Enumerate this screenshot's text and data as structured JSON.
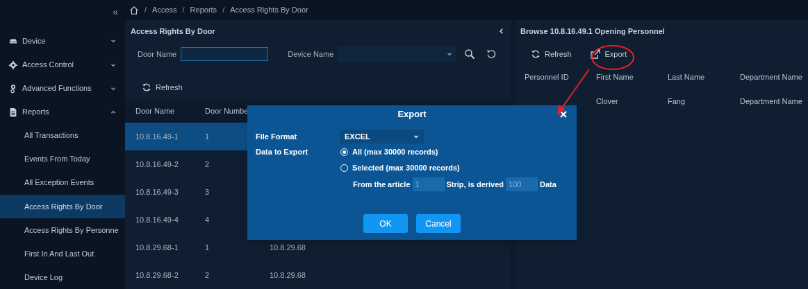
{
  "sidebar": {
    "collapse": "«",
    "menus": [
      {
        "label": "Device",
        "expanded": false
      },
      {
        "label": "Access Control",
        "expanded": false
      },
      {
        "label": "Advanced Functions",
        "expanded": false
      },
      {
        "label": "Reports",
        "expanded": true,
        "children": [
          {
            "label": "All Transactions",
            "selected": false
          },
          {
            "label": "Events From Today",
            "selected": false
          },
          {
            "label": "All Exception Events",
            "selected": false
          },
          {
            "label": "Access Rights By Door",
            "selected": true
          },
          {
            "label": "Access Rights By Personne",
            "selected": false
          },
          {
            "label": "First In And Last Out",
            "selected": false
          },
          {
            "label": "Device Log",
            "selected": false
          }
        ]
      }
    ]
  },
  "breadcrumb": {
    "separator": "/",
    "items": [
      "Access",
      "Reports",
      "Access Rights By Door"
    ]
  },
  "door_panel": {
    "title": "Access Rights By Door",
    "filters": [
      {
        "label": "Door Name",
        "kind": "text"
      },
      {
        "label": "Device Name",
        "kind": "select"
      }
    ],
    "refresh": "Refresh",
    "columns": [
      "Door Name",
      "Door Numbe"
    ],
    "rows": [
      {
        "cells": [
          "10.8.16.49-1",
          "1"
        ],
        "selected": true
      },
      {
        "cells": [
          "10.8.16.49-2",
          "2"
        ],
        "selected": false
      },
      {
        "cells": [
          "10.8.16.49-3",
          "3"
        ],
        "selected": false
      },
      {
        "cells": [
          "10.8.16.49-4",
          "4"
        ],
        "selected": false
      },
      {
        "cells": [
          "10.8.29.68-1",
          "1",
          "10.8.29.68"
        ],
        "selected": false
      },
      {
        "cells": [
          "10.8.29.68-2",
          "2",
          "10.8.29.68"
        ],
        "selected": false
      }
    ]
  },
  "personnel_panel": {
    "title": "Browse 10.8.16.49.1 Opening Personnel",
    "refresh": "Refresh",
    "export": "Export",
    "columns": [
      "Personnel ID",
      "First Name",
      "Last Name",
      "Department Name"
    ],
    "rows": [
      {
        "first_name": "Clover",
        "last_name": "Fang",
        "department_name": "Department Name"
      }
    ]
  },
  "export_dialog": {
    "title": "Export",
    "file_format_label": "File Format",
    "file_format": "EXCEL",
    "data_label": "Data to Export",
    "options": [
      {
        "label": "All (max 30000 records)",
        "selected": true
      },
      {
        "label": "Selected (max 30000 records)",
        "selected": false
      }
    ],
    "range": {
      "prefix": "From the article",
      "start": "1",
      "middle": "Strip, is derived",
      "count": "100",
      "suffix": "Data",
      "disabled": true
    },
    "buttons": [
      "OK",
      "Cancel"
    ]
  }
}
